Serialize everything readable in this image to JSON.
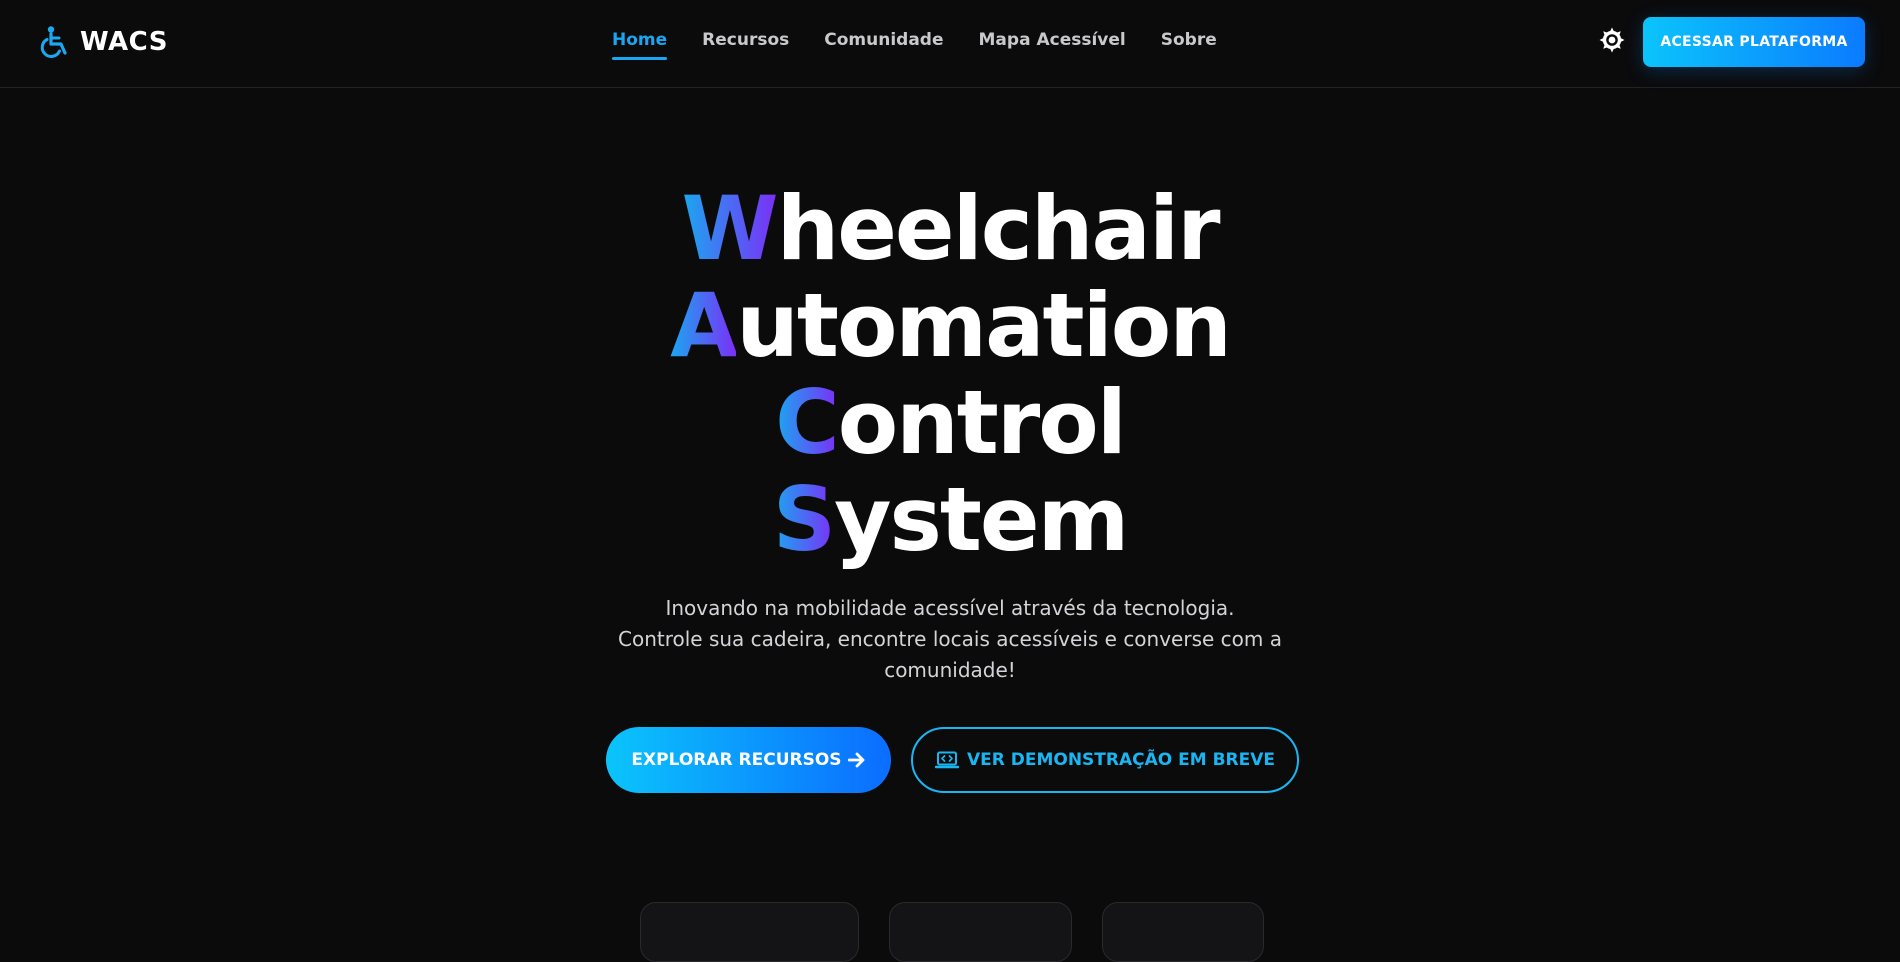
{
  "brand": {
    "name": "WACS",
    "icon": "wheelchair-icon",
    "icon_color": "#1aa8f0"
  },
  "nav": {
    "items": [
      {
        "label": "Home",
        "active": true
      },
      {
        "label": "Recursos",
        "active": false
      },
      {
        "label": "Comunidade",
        "active": false
      },
      {
        "label": "Mapa Acessível",
        "active": false
      },
      {
        "label": "Sobre",
        "active": false
      }
    ]
  },
  "header": {
    "theme_toggle_icon": "sun-icon",
    "cta_label": "ACESSAR PLATAFORMA"
  },
  "hero": {
    "title_lines": [
      {
        "initial": "W",
        "rest": "heelchair"
      },
      {
        "initial": "A",
        "rest": "utomation"
      },
      {
        "initial": "C",
        "rest": "ontrol"
      },
      {
        "initial": "S",
        "rest": "ystem"
      }
    ],
    "subtitle_lines": [
      "Inovando na mobilidade acessível através da tecnologia.",
      "Controle sua cadeira, encontre locais acessíveis e converse com a",
      "comunidade!"
    ],
    "primary_button": {
      "label": "EXPLORAR RECURSOS",
      "icon": "arrow-right-icon"
    },
    "secondary_button": {
      "label": "VER DEMONSTRAÇÃO EM BREVE",
      "icon": "laptop-code-icon"
    }
  },
  "colors": {
    "background": "#0b0b0c",
    "accent": "#19a7f3",
    "gradient_start": "#0bc4fb",
    "gradient_end": "#0b6dff",
    "title_gradient_end": "#7b2ff7"
  }
}
